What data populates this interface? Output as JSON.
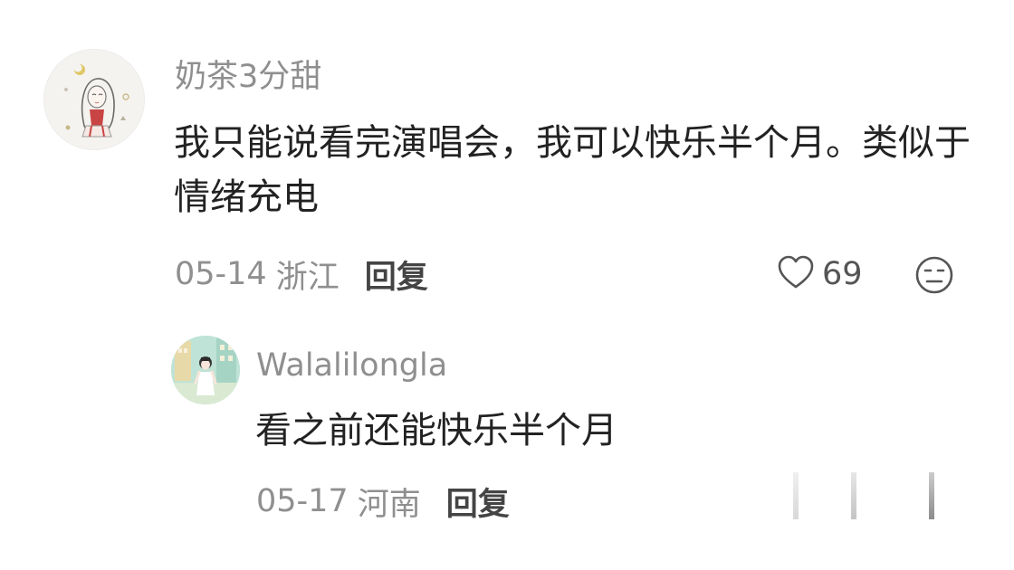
{
  "comments": [
    {
      "user": "奶茶3分甜",
      "text": "我只能说看完演唱会，我可以快乐半个月。类似于情绪充电",
      "date": "05-14",
      "location": "浙江",
      "reply_label": "回复",
      "likes": "69",
      "avatar_icon": "girl-doodle-avatar",
      "like_icon": "heart-outline-icon",
      "emoji_icon": "neutral-face-icon"
    },
    {
      "user": "Walalilongla",
      "text": "看之前还能快乐半个月",
      "date": "05-17",
      "location": "河南",
      "reply_label": "回复",
      "avatar_icon": "girl-street-avatar"
    }
  ],
  "colors": {
    "text_primary": "#222222",
    "text_secondary": "#8f8f8f",
    "reply_label": "#444444",
    "icon_gray": "#555555"
  }
}
